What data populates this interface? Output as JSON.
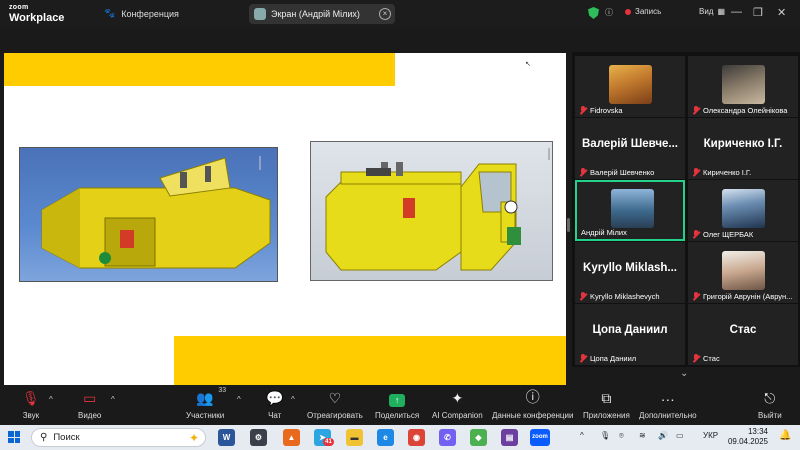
{
  "app": {
    "logo_top": "zoom",
    "logo_bottom": "Workplace",
    "meeting_label": "Конференция"
  },
  "screen_share": {
    "label": "Экран (Андрій Мілих)"
  },
  "top_right": {
    "record_label": "Запись",
    "view_label": "Вид"
  },
  "slide": {
    "colors": {
      "accent": "#ffcc00"
    }
  },
  "participants": [
    {
      "display": "",
      "name": "Fidrovska"
    },
    {
      "display": "",
      "name": "Олександра Олейнікова"
    },
    {
      "display": "Валерій Шевче...",
      "name": "Валерій Шевченко"
    },
    {
      "display": "Кириченко І.Г.",
      "name": "Кириченко І.Г."
    },
    {
      "display": "",
      "name": "Андрій Мілих"
    },
    {
      "display": "",
      "name": "Олег ЩЕРБАК"
    },
    {
      "display": "Kyryllo Miklash...",
      "name": "Kyryllo Miklashevych"
    },
    {
      "display": "",
      "name": "Григорій Аврунін (Аврун..."
    },
    {
      "display": "Цопа Даниил",
      "name": "Цопа Даниил"
    },
    {
      "display": "Стас",
      "name": "Стас"
    }
  ],
  "toolbar": {
    "audio": "Звук",
    "video": "Видео",
    "participants": "Участники",
    "participants_count": "33",
    "chat": "Чат",
    "react": "Отреагировать",
    "share": "Поделиться",
    "ai": "AI Companion",
    "info": "Данные конференции",
    "apps": "Приложения",
    "more": "Дополнительно",
    "leave": "Выйти"
  },
  "taskbar": {
    "search_placeholder": "Поиск",
    "telegram_badge": "41",
    "word_icon": "W",
    "zoom_icon": "zoom",
    "lang": "УКР",
    "time": "13:34",
    "date": "09.04.2025"
  }
}
